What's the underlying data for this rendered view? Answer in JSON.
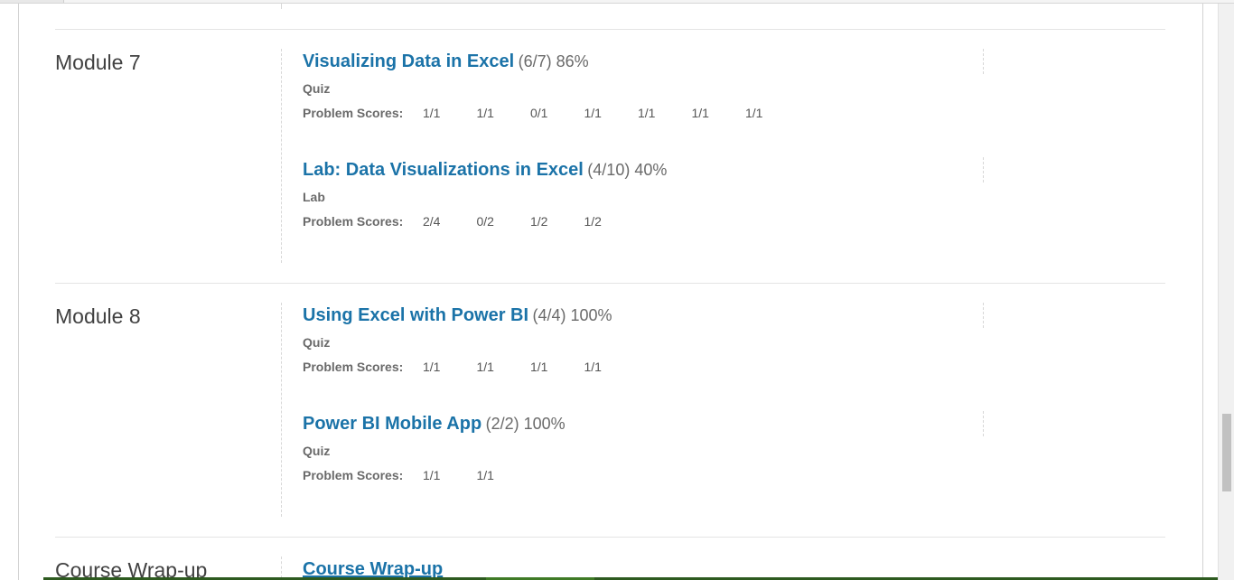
{
  "modules": [
    {
      "name": "Module 7",
      "assignments": [
        {
          "title": "Visualizing Data in Excel",
          "score_info": "(6/7) 86%",
          "type": "Quiz",
          "scores_label": "Problem Scores:",
          "scores": [
            "1/1",
            "1/1",
            "0/1",
            "1/1",
            "1/1",
            "1/1",
            "1/1"
          ]
        },
        {
          "title": "Lab: Data Visualizations in Excel",
          "score_info": "(4/10) 40%",
          "type": "Lab",
          "scores_label": "Problem Scores:",
          "scores": [
            "2/4",
            "0/2",
            "1/2",
            "1/2"
          ]
        }
      ]
    },
    {
      "name": "Module 8",
      "assignments": [
        {
          "title": "Using Excel with Power BI",
          "score_info": "(4/4) 100%",
          "type": "Quiz",
          "scores_label": "Problem Scores:",
          "scores": [
            "1/1",
            "1/1",
            "1/1",
            "1/1"
          ]
        },
        {
          "title": "Power BI Mobile App",
          "score_info": "(2/2) 100%",
          "type": "Quiz",
          "scores_label": "Problem Scores:",
          "scores": [
            "1/1",
            "1/1"
          ]
        }
      ]
    },
    {
      "name": "Course Wrap-up",
      "assignments": [
        {
          "title": "Course Wrap-up",
          "score_info": "",
          "type": "",
          "scores_label": "",
          "scores": []
        }
      ]
    }
  ],
  "colors": {
    "link": "#1b73a8",
    "muted_text": "#6a6a6a",
    "divider": "#e4e4e4"
  }
}
